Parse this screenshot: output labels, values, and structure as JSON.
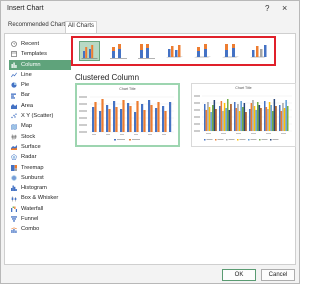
{
  "window": {
    "title": "Insert Chart",
    "help_glyph": "?",
    "close_glyph": "×"
  },
  "tabs": [
    {
      "label": "Recommended Charts"
    },
    {
      "label": "All Charts"
    }
  ],
  "sidebar": {
    "items": [
      {
        "label": "Recent",
        "icon": "recent-icon"
      },
      {
        "label": "Templates",
        "icon": "templates-icon"
      },
      {
        "label": "Column",
        "icon": "column-chart-icon",
        "selected": true
      },
      {
        "label": "Line",
        "icon": "line-chart-icon"
      },
      {
        "label": "Pie",
        "icon": "pie-chart-icon"
      },
      {
        "label": "Bar",
        "icon": "bar-chart-icon"
      },
      {
        "label": "Area",
        "icon": "area-chart-icon"
      },
      {
        "label": "X Y (Scatter)",
        "icon": "scatter-chart-icon"
      },
      {
        "label": "Map",
        "icon": "map-chart-icon"
      },
      {
        "label": "Stock",
        "icon": "stock-chart-icon"
      },
      {
        "label": "Surface",
        "icon": "surface-chart-icon"
      },
      {
        "label": "Radar",
        "icon": "radar-chart-icon"
      },
      {
        "label": "Treemap",
        "icon": "treemap-chart-icon"
      },
      {
        "label": "Sunburst",
        "icon": "sunburst-chart-icon"
      },
      {
        "label": "Histogram",
        "icon": "histogram-chart-icon"
      },
      {
        "label": "Box & Whisker",
        "icon": "box-whisker-chart-icon"
      },
      {
        "label": "Waterfall",
        "icon": "waterfall-chart-icon"
      },
      {
        "label": "Funnel",
        "icon": "funnel-chart-icon"
      },
      {
        "label": "Combo",
        "icon": "combo-chart-icon"
      }
    ]
  },
  "subtypes": [
    {
      "name": "clustered-column",
      "selected": true
    },
    {
      "name": "stacked-column"
    },
    {
      "name": "100-percent-stacked-column"
    },
    {
      "name": "3d-clustered-column"
    },
    {
      "name": "3d-stacked-column"
    },
    {
      "name": "3d-100-percent-stacked-column"
    },
    {
      "name": "3d-column"
    }
  ],
  "main": {
    "section_title": "Clustered Column",
    "preview1_title": "Chart Title",
    "preview2_title": "Chart Title"
  },
  "colors": {
    "accent": "#5fa37b",
    "highlight": "#e0202a",
    "blue": "#4472c4",
    "orange": "#ed7d31",
    "gray": "#a5a5a5",
    "gold": "#ffc000"
  },
  "footer": {
    "ok_label": "OK",
    "cancel_label": "Cancel"
  }
}
